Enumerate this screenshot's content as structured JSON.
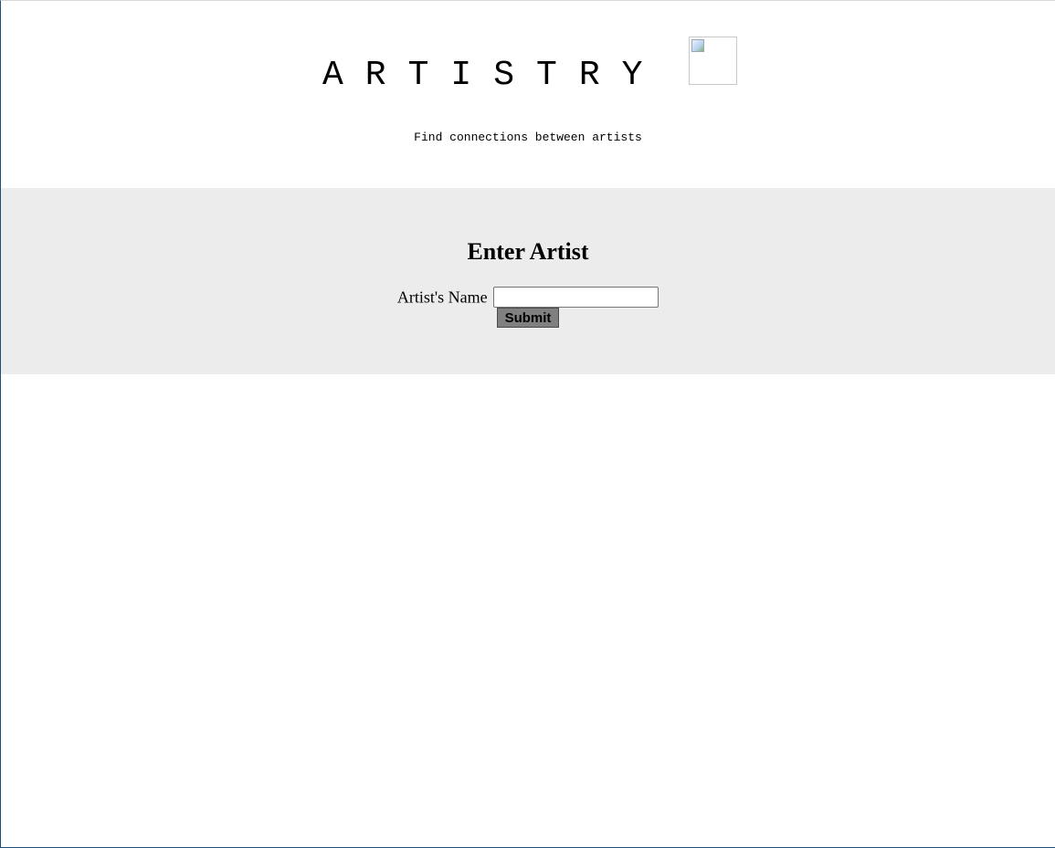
{
  "header": {
    "logo_text": "ARTISTRY",
    "logo_image_alt": "",
    "subtitle": "Find connections between artists"
  },
  "form": {
    "heading": "Enter Artist",
    "artist_label": "Artist's Name",
    "artist_value": "",
    "submit_label": "Submit"
  }
}
